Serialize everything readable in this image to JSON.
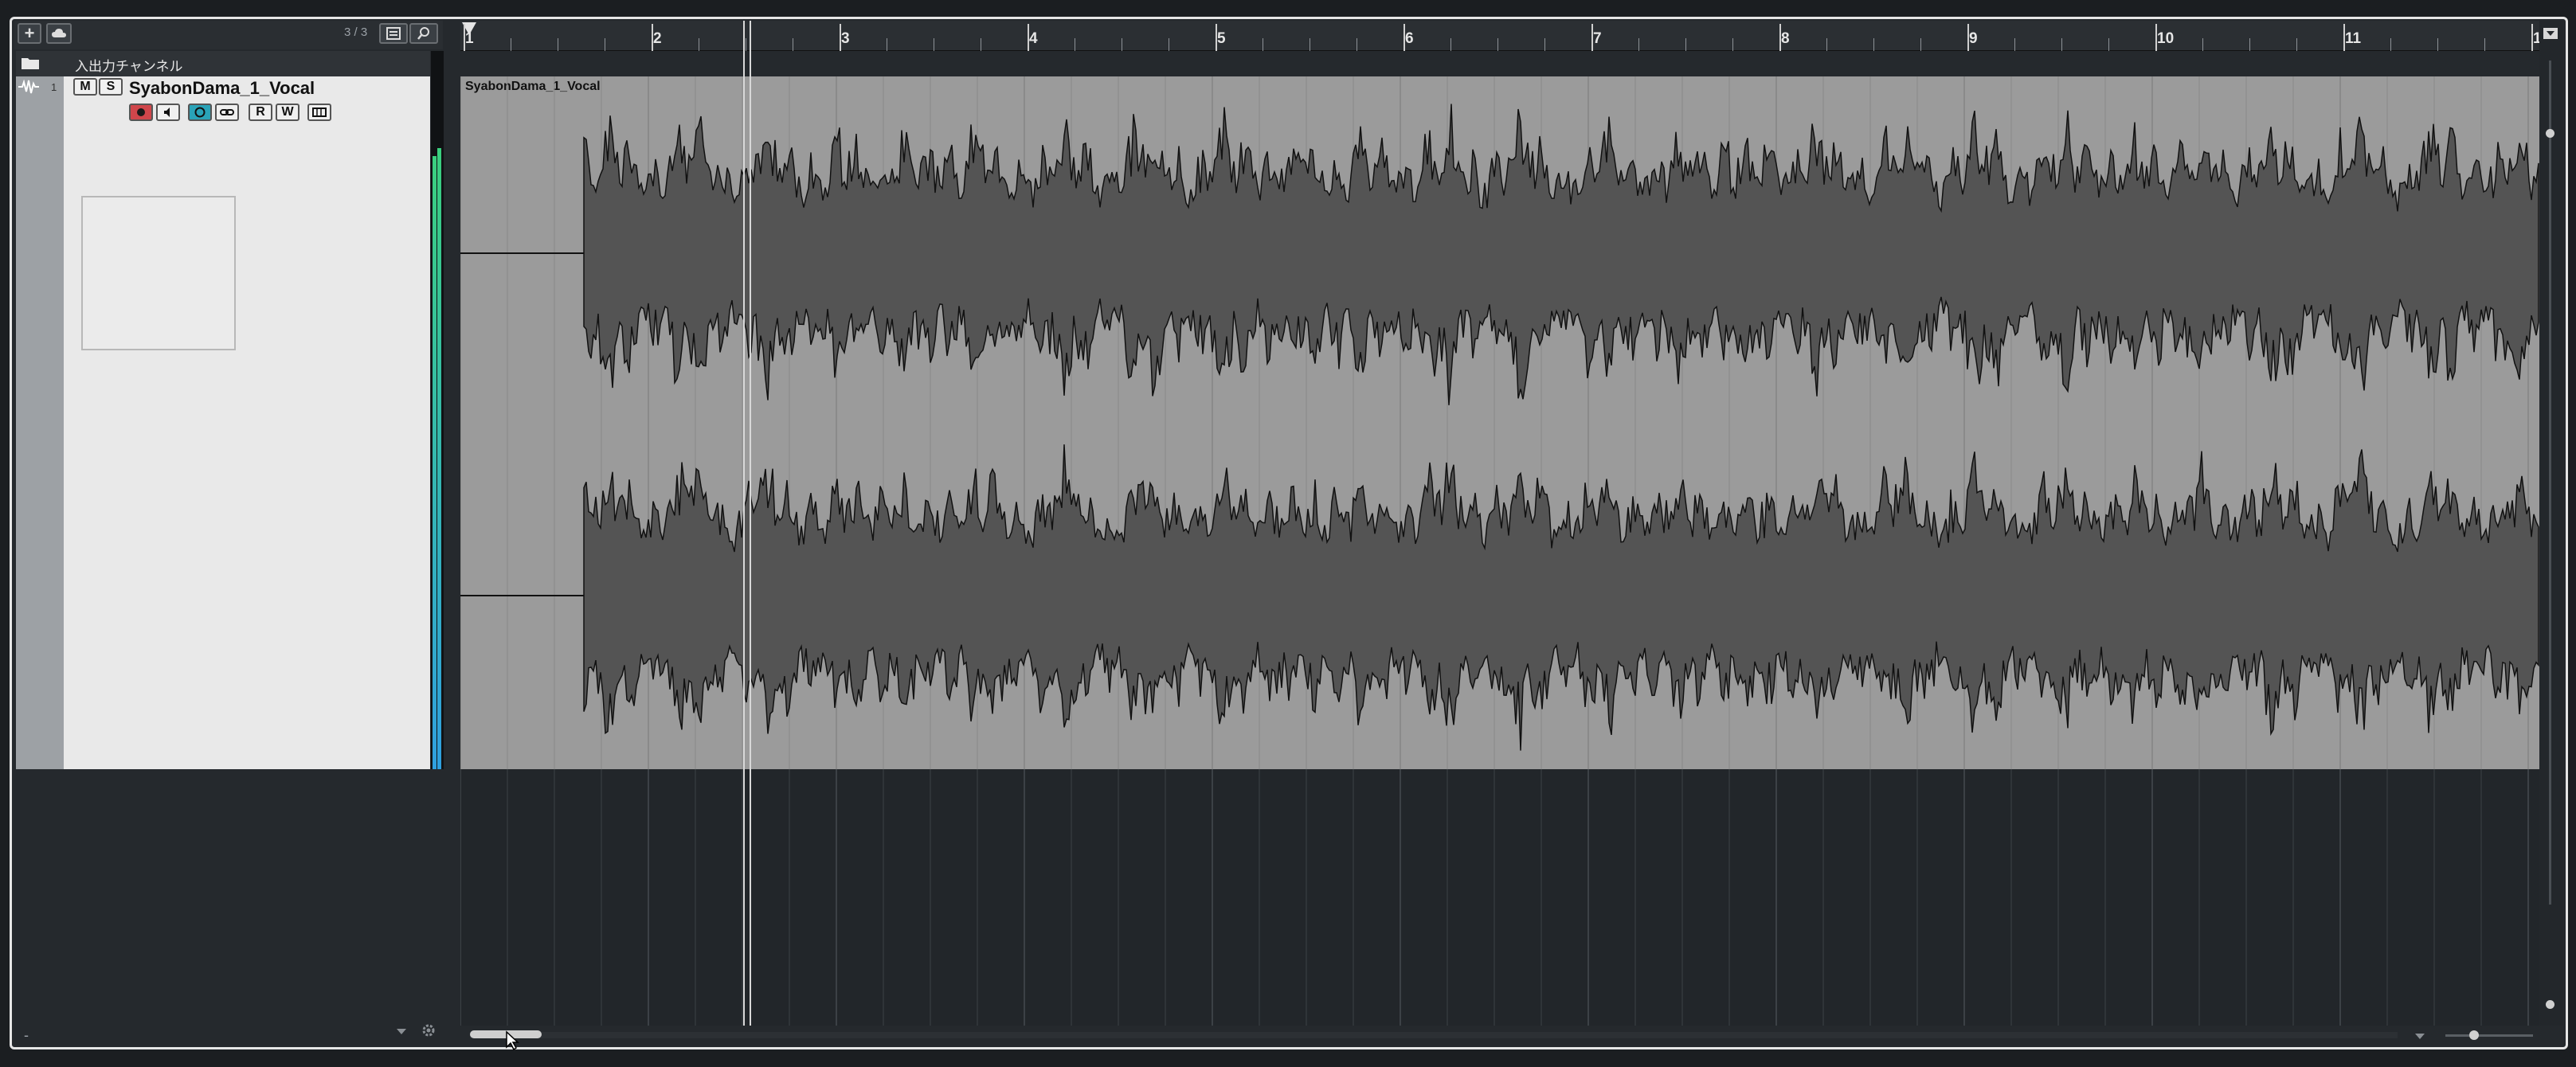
{
  "toolbar": {
    "add_label": "+",
    "track_count": "3 / 3"
  },
  "io_channel": {
    "label": "入出力チャンネル"
  },
  "track": {
    "number": "1",
    "name": "SyabonDama_1_Vocal",
    "buttons": {
      "mute": "M",
      "solo": "S",
      "read": "R",
      "write": "W"
    }
  },
  "ruler": {
    "bars": [
      "1",
      "2",
      "3",
      "4",
      "5",
      "6",
      "7",
      "8",
      "9",
      "10",
      "11",
      "1"
    ]
  },
  "event": {
    "title": "SyabonDama_1_Vocal"
  },
  "bottom": {
    "minus_label": "-"
  },
  "colors": {
    "record": "#d0464b",
    "monitor_active": "#2aa3b8",
    "meter": "#3ad07e",
    "event_bg": "#9b9b9b",
    "waveform": "#545454"
  }
}
